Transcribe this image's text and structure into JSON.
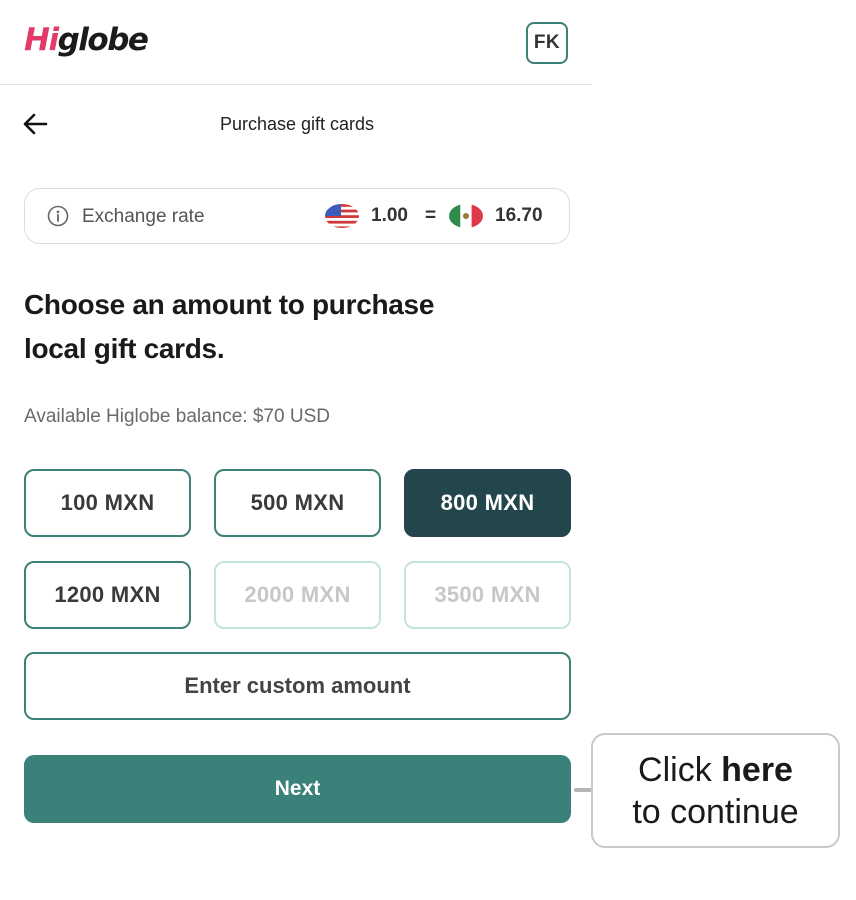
{
  "header": {
    "logo_hi": "Hi",
    "logo_rest": "globe",
    "avatar_initials": "FK"
  },
  "page": {
    "title": "Purchase gift cards"
  },
  "exchange": {
    "label": "Exchange rate",
    "from_value": "1.00",
    "equals": "=",
    "to_value": "16.70"
  },
  "heading": {
    "line1": "Choose an amount to purchase",
    "line2": "local gift cards."
  },
  "balance_text": "Available Higlobe balance: $70 USD",
  "amounts": [
    {
      "label": "100 MXN",
      "state": "default"
    },
    {
      "label": "500 MXN",
      "state": "default"
    },
    {
      "label": "800 MXN",
      "state": "selected"
    },
    {
      "label": "1200 MXN",
      "state": "default"
    },
    {
      "label": "2000 MXN",
      "state": "disabled"
    },
    {
      "label": "3500 MXN",
      "state": "disabled"
    }
  ],
  "custom_amount_label": "Enter custom amount",
  "next_label": "Next",
  "callout": {
    "prefix": "Click ",
    "bold": "here",
    "line2": "to continue"
  },
  "colors": {
    "brand_pink": "#e23b6a",
    "teal": "#3a8179",
    "selected_dark": "#22464b",
    "disabled_border": "#c4e3de"
  }
}
